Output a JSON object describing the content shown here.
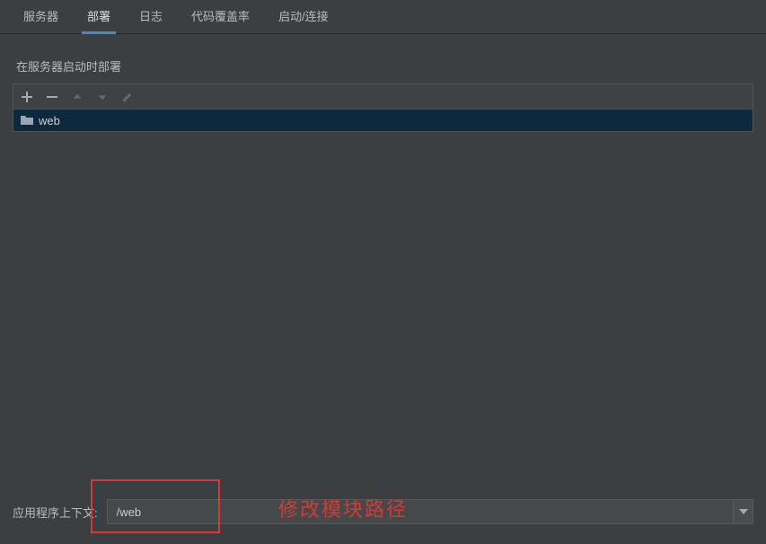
{
  "tabs": {
    "server": "服务器",
    "deploy": "部署",
    "logs": "日志",
    "coverage": "代码覆盖率",
    "startup": "启动/连接"
  },
  "sectionLabel": "在服务器启动时部署",
  "list": {
    "item0": "web"
  },
  "contextLabel": "应用程序上下文:",
  "contextValue": "/web",
  "annotation": "修改模块路径"
}
